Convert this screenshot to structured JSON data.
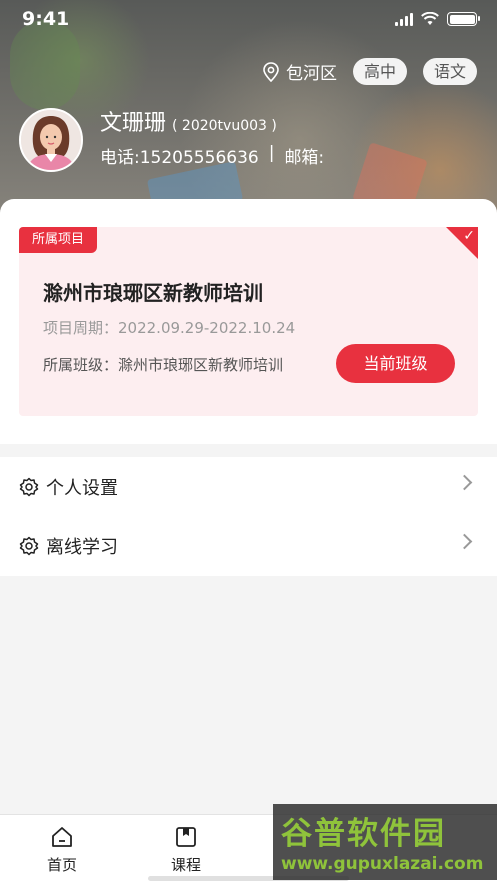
{
  "status_bar": {
    "time": "9:41"
  },
  "header": {
    "location": "包河区",
    "tags": [
      "高中",
      "语文"
    ],
    "user": {
      "name": "文珊珊",
      "id_text": "( 2020tvu003 )",
      "phone_text": "电话:15205556636",
      "separator": "|",
      "email_text": "邮箱:"
    }
  },
  "project_card": {
    "tag_label": "所属项目",
    "title": "滁州市琅琊区新教师培训",
    "period_text": "项目周期：2022.09.29-2022.10.24",
    "class_text": "所属班级：滁州市琅琊区新教师培训",
    "current_button_label": "当前班级",
    "accent_color": "#e8313f"
  },
  "menu": {
    "items": [
      {
        "label": "个人设置",
        "icon": "gear-icon"
      },
      {
        "label": "离线学习",
        "icon": "gear-icon"
      }
    ]
  },
  "tabbar": {
    "tabs": [
      {
        "label": "首页",
        "icon": "home-icon"
      },
      {
        "label": "课程",
        "icon": "book-icon"
      }
    ]
  },
  "watermark": {
    "title": "谷普软件园",
    "url": "www.gupuxlazai.com",
    "color": "#8fc33b"
  }
}
